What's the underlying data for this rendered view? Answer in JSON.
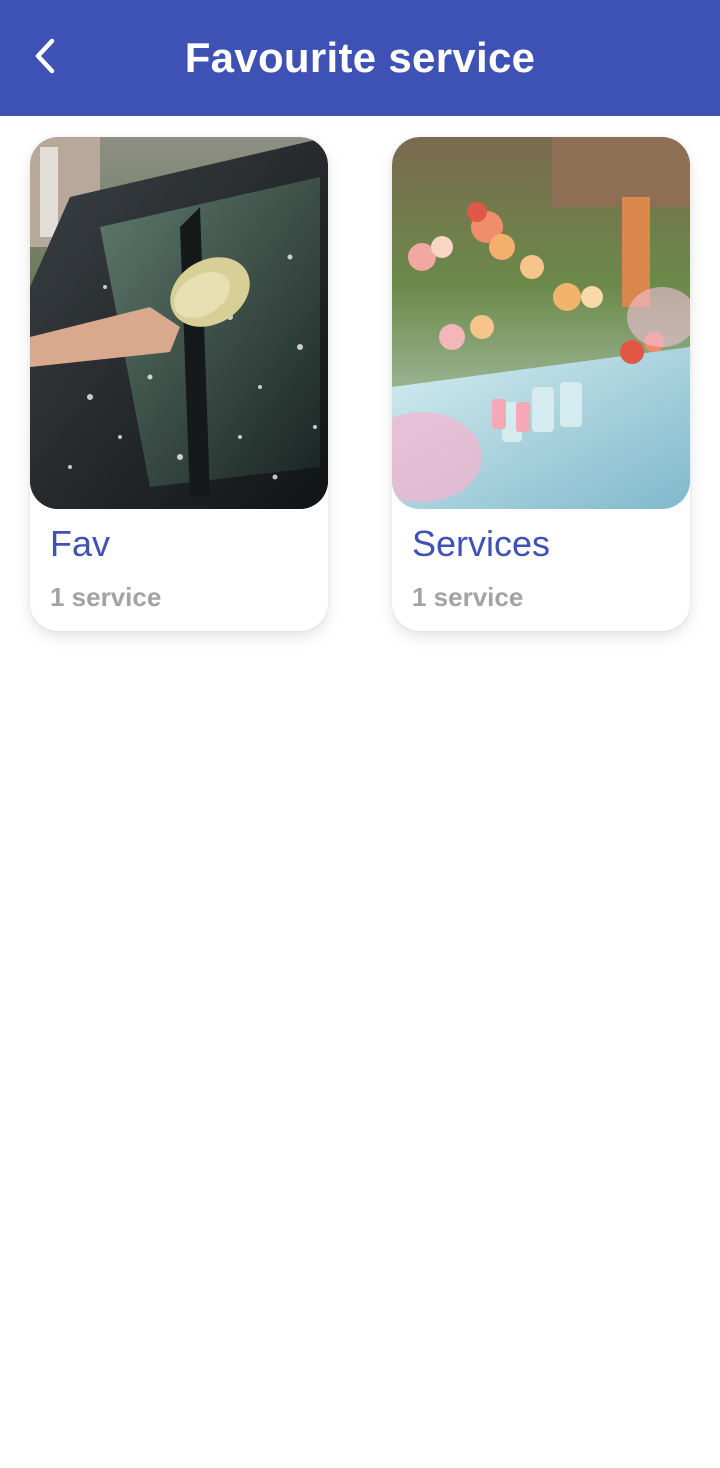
{
  "header": {
    "title": "Favourite service",
    "back_icon": "chevron-left-icon",
    "background": "#3e51b5",
    "text_color": "#ffffff"
  },
  "categories": [
    {
      "title": "Fav",
      "subtitle": "1 service",
      "image": "car-wash-photo"
    },
    {
      "title": "Services",
      "subtitle": "1 service",
      "image": "party-food-table-photo"
    }
  ],
  "colors": {
    "accent": "#3e51b5",
    "subtitle": "#a3a3a3"
  }
}
